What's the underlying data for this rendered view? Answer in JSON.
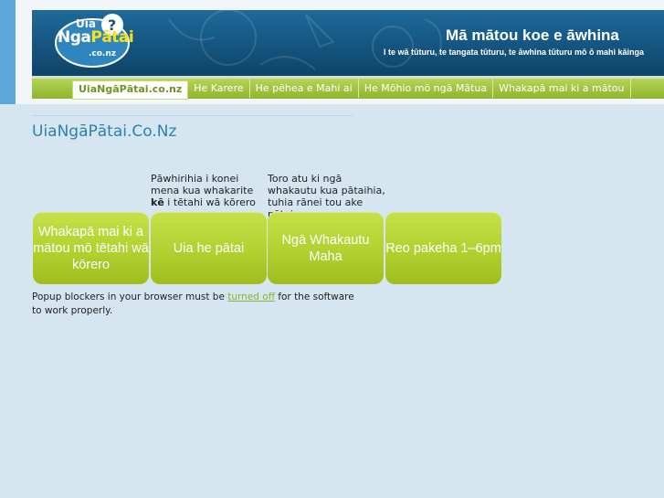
{
  "header": {
    "logo": {
      "line1": "Uia",
      "line2a": "Nga",
      "line2b": "Pātai",
      "line3": ".co.nz"
    },
    "tagline_big": "Mā mātou koe e āwhina",
    "tagline_small": "I te wā tūturu, te tangata tūturu, te āwhina tūturu mō ō  mahi kāinga"
  },
  "nav": {
    "items": [
      "UiaNgāPātai.co.nz",
      "He Karere",
      "He pēhea e Mahi ai",
      "He Mōhio mō ngā Mātua",
      "Whakapā mai ki a mātou"
    ]
  },
  "main": {
    "site_title": "UiaNgāPātai.Co.Nz",
    "col1_pre": "Pāwhirihia i konei mena kua whakarite ",
    "col1_bold": "kē",
    "col1_post": " i tētahi wā kōrero",
    "col2": "Toro atu ki ngā whakautu kua pātaihia, tuhia rānei tou ake pātai",
    "buttons": [
      "Whakapā mai ki a mātou mō tētahi wā kōrero",
      "Uia he pātai",
      "Ngā Whakautu Maha",
      "Reo pakeha 1–6pm"
    ],
    "note_pre": "Popup blockers in your browser must be ",
    "note_link": "turned off",
    "note_post": " for the software to work properly."
  },
  "colors": {
    "background": "#d5e6f0",
    "banner": "#14557f",
    "nav_green": "#9fbd2c",
    "button_green": "#b4d232",
    "title_blue": "#2f7fb2"
  }
}
